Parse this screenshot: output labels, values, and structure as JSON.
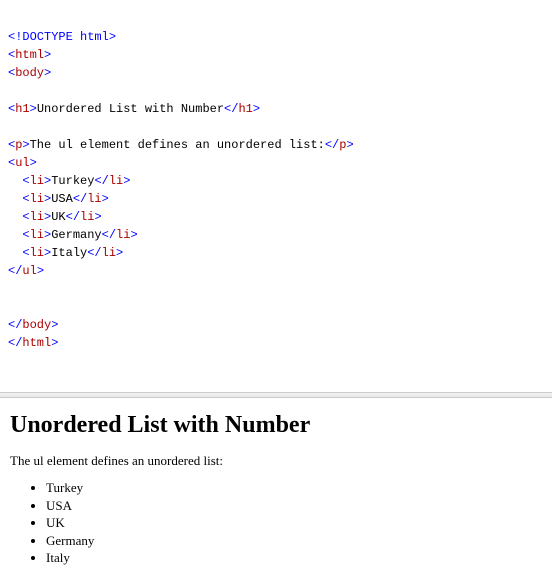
{
  "code": {
    "doctype": "<!DOCTYPE html>",
    "html_open": "html",
    "body_open": "body",
    "h1_tag": "h1",
    "h1_text": "Unordered List with Number",
    "p_tag": "p",
    "p_text": "The ul element defines an unordered list:",
    "ul_tag": "ul",
    "li_tag": "li",
    "items": [
      "Turkey",
      "USA",
      "UK",
      "Germany",
      "Italy"
    ]
  },
  "rendered": {
    "heading": "Unordered List with Number",
    "paragraph": "The ul element defines an unordered list:",
    "items": [
      "Turkey",
      "USA",
      "UK",
      "Germany",
      "Italy"
    ]
  }
}
